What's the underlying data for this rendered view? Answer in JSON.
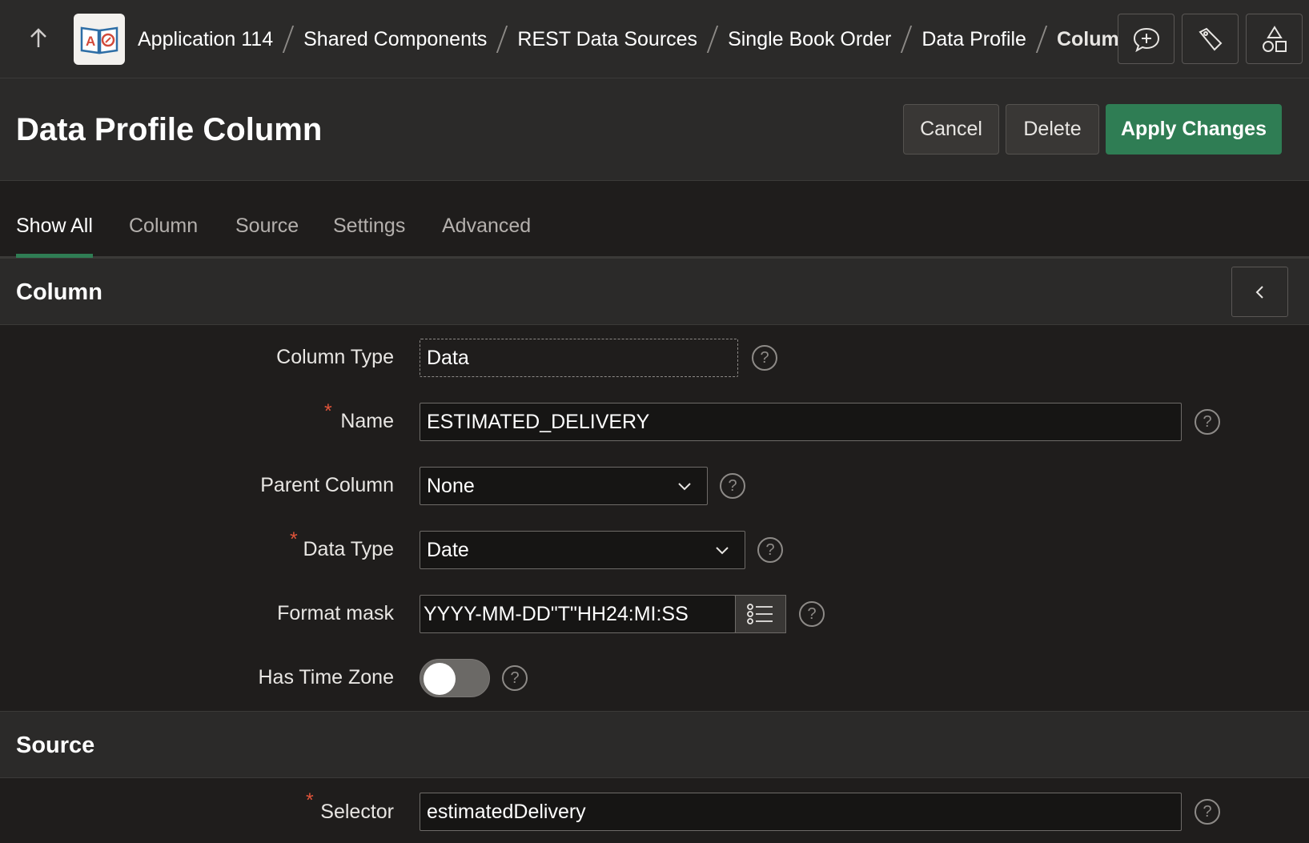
{
  "topbar": {
    "breadcrumb": [
      "Application 114",
      "Shared Components",
      "REST Data Sources",
      "Single Book Order",
      "Data Profile",
      "Column"
    ]
  },
  "header": {
    "title": "Data Profile Column",
    "cancel_label": "Cancel",
    "delete_label": "Delete",
    "apply_label": "Apply Changes"
  },
  "tabs": [
    "Show All",
    "Column",
    "Source",
    "Settings",
    "Advanced"
  ],
  "sections": {
    "column": {
      "title": "Column",
      "column_type_label": "Column Type",
      "column_type_value": "Data",
      "name_label": "Name",
      "name_value": "ESTIMATED_DELIVERY",
      "parent_column_label": "Parent Column",
      "parent_column_value": "None",
      "data_type_label": "Data Type",
      "data_type_value": "Date",
      "format_mask_label": "Format mask",
      "format_mask_value": "YYYY-MM-DD\"T\"HH24:MI:SS",
      "has_time_zone_label": "Has Time Zone"
    },
    "source": {
      "title": "Source",
      "selector_label": "Selector",
      "selector_value": "estimatedDelivery"
    }
  },
  "colors": {
    "accent": "#2f7d54",
    "required": "#e0543a",
    "background": "#1f1d1c"
  }
}
